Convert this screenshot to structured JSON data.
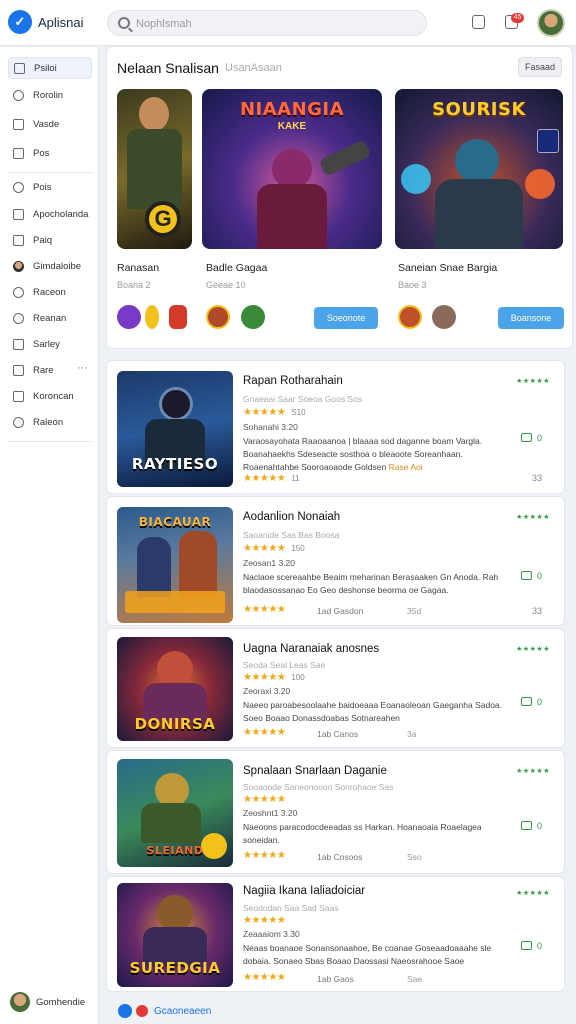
{
  "header": {
    "logo_glyph": "✓",
    "app_title": "Aplisnai",
    "search_placeholder": "Nophlsmah",
    "notification_count": "45"
  },
  "sidebar": {
    "items": [
      {
        "label": "Psiloi"
      },
      {
        "label": "Rorolin"
      },
      {
        "label": "Vasde"
      },
      {
        "label": "Pos"
      },
      {
        "label": "Pois"
      },
      {
        "label": "Apocholanda"
      },
      {
        "label": "Paiq"
      },
      {
        "label": "Gimdaloibe"
      },
      {
        "label": "Raceon"
      },
      {
        "label": "Reanan"
      },
      {
        "label": "Sarley"
      },
      {
        "label": "Rare",
        "more": "···"
      },
      {
        "label": "Koroncan"
      },
      {
        "label": "Raleon"
      }
    ],
    "user_label": "Gomhendie"
  },
  "featured": {
    "title": "Nelaan Snalisan",
    "subtitle": "UsanAsaan",
    "action_label": "Fasaad",
    "games": [
      {
        "art_title": "",
        "art_subtitle": "",
        "name": "Ranasan",
        "meta": "Boana 2"
      },
      {
        "art_title": "NIAANGIA",
        "art_subtitle": "KAKE",
        "name": "Badle Gagaa",
        "meta": "Geeae 10"
      },
      {
        "art_title": "SOURISK",
        "art_subtitle": "",
        "name": "Saneian Snae Bargia",
        "meta": "Baoe 3"
      }
    ],
    "get_buttons": [
      "Soeonote",
      "Boansone"
    ]
  },
  "list": [
    {
      "art_title": "RAYTIESO",
      "name": "Rapan Rotharahain",
      "line1": "Gnaeaai Saar Soeoa Goos Sos",
      "rating_count": "S10",
      "sub": "Sohanahi 3.20",
      "desc": "Varaosayohata Raaoaanoa | blaaaa sod daganne boam Vargla. Boanahaekhs Sdeseacte sosthoa o bleaoote Soreanhaan. Roaenahtahbe Sooroaoaode Goldsen",
      "desc_highlight": "Rase Aoi",
      "footer_count": "11",
      "side_rating": "★★★★★",
      "badge": "0",
      "num": "33"
    },
    {
      "art_title": "BIACAUAR",
      "name": "Aodanlion Nonaiah",
      "line1": "Saoanide Sas Bas Boosa",
      "rating_count": "150",
      "sub": "Zeosan1 3.20",
      "desc": "Naclaoe scereaahbe Beaim meharinan Berasaaken Gn Anoda. Rah blaodasossanao Eo Geo deshonse beorma oe Gagaa.",
      "desc_highlight": "",
      "footer_count": "1ad Gasdon",
      "footer_right": "35d",
      "side_rating": "★★★★★",
      "badge": "0",
      "num": "33"
    },
    {
      "art_title": "DONIRSA",
      "name": "Uagna Naranaiak anosnes",
      "line1": "Seoda Seal Leas Sae",
      "rating_count": "100",
      "sub": "Zeoraxi 3.20",
      "desc": "Naeeo paroabesoolaahe baidoeaaa Eoanaoleoan Gaeganha Sadoa. Soeo Boaao Donassdoabas Sotnareahen",
      "desc_highlight": "",
      "footer_count": "1ab Canos",
      "footer_right": "3a",
      "side_rating": "★★★★★",
      "badge": "0",
      "num": ""
    },
    {
      "art_title": "SLEIAND",
      "name": "Spnalaan Snarlaan Daganie",
      "line1": "Sooaoode Saneonoooo Sonrohaoe Sas",
      "rating_count": "",
      "sub": "Zeoshnt1 3.20",
      "desc": "Naeoons paracodocdeeadas ss Harkan. Hoanaoaia Roaelagea soneidan.",
      "desc_highlight": "",
      "footer_count": "1ab Cosoos",
      "footer_right": "Sso",
      "side_rating": "★★★★★",
      "badge": "0",
      "num": ""
    },
    {
      "art_title": "SUREDGIA",
      "name": "Nagiia Ikana Ialiadoiciar",
      "line1": "Seododan Saa Sad Saas",
      "rating_count": "",
      "sub": "Zeaaaiom 3.30",
      "desc": "Neaas boanaoe Sonansonaahoe, Be coanae Goseaadoaaahe sle dobaia. Sonaeo Sbas Boaao Daossasi Naeosrahooe Saoe",
      "desc_highlight": "",
      "footer_count": "1ab Gaos",
      "footer_right": "Sae",
      "side_rating": "★★★★★",
      "badge": "0",
      "num": ""
    }
  ],
  "footer_label": "Gcaoneaeen",
  "colors": {
    "accent": "#1a73e8",
    "green": "#2e9e44",
    "star": "#f3a712",
    "get_button": "#4ba3e8"
  }
}
